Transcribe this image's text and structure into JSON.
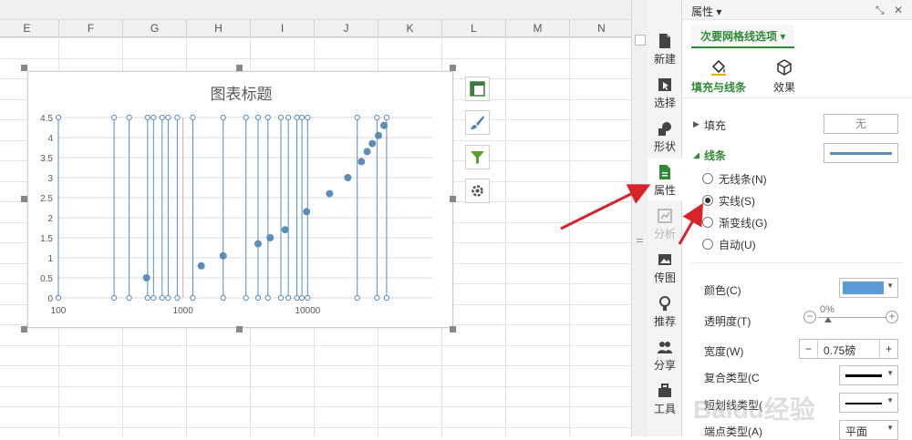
{
  "columns": [
    "E",
    "F",
    "G",
    "H",
    "I",
    "J",
    "K",
    "L",
    "M",
    "N"
  ],
  "chart": {
    "title": "图表标题",
    "series_color": "#5b8db8",
    "grid_color": "#d9d9d9",
    "red_line_color": "#e8a0a0"
  },
  "chart_data": {
    "type": "scatter",
    "title": "图表标题",
    "x_scale": "log",
    "xlim": [
      100,
      100000
    ],
    "ylim": [
      0,
      4.5
    ],
    "x_ticks": [
      "100",
      "1000",
      "10000"
    ],
    "y_ticks": [
      "0",
      "0.5",
      "1",
      "1.5",
      "2",
      "2.5",
      "3",
      "3.5",
      "4",
      "4.5"
    ],
    "points": [
      {
        "x": 510,
        "y": 0.5
      },
      {
        "x": 1400,
        "y": 0.8
      },
      {
        "x": 2100,
        "y": 1.05
      },
      {
        "x": 4000,
        "y": 1.35
      },
      {
        "x": 5000,
        "y": 1.5
      },
      {
        "x": 6600,
        "y": 1.7
      },
      {
        "x": 9800,
        "y": 2.15
      },
      {
        "x": 15000,
        "y": 2.6
      },
      {
        "x": 21000,
        "y": 3.0
      },
      {
        "x": 27000,
        "y": 3.4
      },
      {
        "x": 30000,
        "y": 3.65
      },
      {
        "x": 33000,
        "y": 3.85
      },
      {
        "x": 37000,
        "y": 4.05
      },
      {
        "x": 41000,
        "y": 4.3
      }
    ],
    "vertical_gridlines_x": [
      100,
      280,
      370,
      520,
      580,
      680,
      760,
      900,
      1200,
      2100,
      3200,
      4000,
      4800,
      6100,
      7000,
      8200,
      9000,
      10000,
      25000,
      36000,
      43000
    ],
    "highlighted_gridline_x": 1000,
    "grid": true
  },
  "chart_tools": {
    "layout_icon": "layout-icon",
    "style_icon": "brush-icon",
    "filter_icon": "filter-icon",
    "settings_icon": "gear-icon"
  },
  "taskbar": {
    "items": [
      {
        "label": "新建",
        "icon": "new-icon"
      },
      {
        "label": "选择",
        "icon": "select-icon"
      },
      {
        "label": "形状",
        "icon": "shape-icon"
      },
      {
        "label": "属性",
        "icon": "property-icon"
      },
      {
        "label": "分析",
        "icon": "analysis-icon"
      },
      {
        "label": "传图",
        "icon": "upload-image-icon"
      },
      {
        "label": "推荐",
        "icon": "recommend-icon"
      },
      {
        "label": "分享",
        "icon": "share-icon"
      },
      {
        "label": "工具",
        "icon": "toolbox-icon"
      }
    ]
  },
  "panel": {
    "title": "属性 ▾",
    "option_tab": "次要网格线选项 ▾",
    "subtabs": [
      {
        "label": "填充与线条"
      },
      {
        "label": "效果"
      }
    ],
    "fill": {
      "label": "填充",
      "value": "无"
    },
    "line": {
      "label": "线条",
      "options": [
        "无线条(N)",
        "实线(S)",
        "渐变线(G)",
        "自动(U)"
      ],
      "selected_index": 1
    },
    "color": {
      "label": "颜色(C)",
      "value_color": "#5b9bd5"
    },
    "transparency": {
      "label": "透明度(T)",
      "value": "0%"
    },
    "width": {
      "label": "宽度(W)",
      "value": "0.75磅",
      "minus": "−",
      "plus": "+"
    },
    "compound": {
      "label": "复合类型(C"
    },
    "dash": {
      "label": "短划线类型("
    },
    "endpoint": {
      "label": "端点类型(A)",
      "value": "平面"
    },
    "accent_color": "#2f8a36"
  },
  "watermark": "Baidu经验"
}
